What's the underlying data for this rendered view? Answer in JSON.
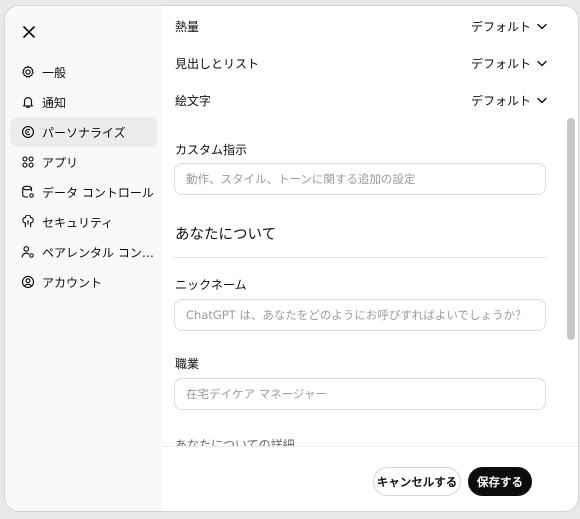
{
  "sidebar": {
    "close_icon": "close-icon",
    "items": [
      {
        "label": "一般",
        "icon": "gear-icon",
        "active": false
      },
      {
        "label": "通知",
        "icon": "bell-icon",
        "active": false
      },
      {
        "label": "パーソナライズ",
        "icon": "personalize-icon",
        "active": true
      },
      {
        "label": "アプリ",
        "icon": "apps-grid-icon",
        "active": false
      },
      {
        "label": "データ コントロール",
        "icon": "data-control-icon",
        "active": false
      },
      {
        "label": "セキュリティ",
        "icon": "security-icon",
        "active": false
      },
      {
        "label": "ペアレンタル コントロール",
        "icon": "parental-icon",
        "active": false
      },
      {
        "label": "アカウント",
        "icon": "account-icon",
        "active": false
      }
    ]
  },
  "settings": {
    "enthusiasm": {
      "label": "熱量",
      "value": "デフォルト"
    },
    "headings_lists": {
      "label": "見出しとリスト",
      "value": "デフォルト"
    },
    "emoji": {
      "label": "絵文字",
      "value": "デフォルト"
    }
  },
  "custom_instructions": {
    "label": "カスタム指示",
    "placeholder": "動作、スタイル、トーンに関する追加の設定"
  },
  "about_you": {
    "title": "あなたについて",
    "nickname": {
      "label": "ニックネーム",
      "placeholder": "ChatGPT は、あなたをどのようにお呼びすればよいでしょうか？"
    },
    "occupation": {
      "label": "職業",
      "placeholder": "在宅デイケア マネージャー"
    },
    "more_label": "あなたについての詳細"
  },
  "footer": {
    "cancel_label": "キャンセルする",
    "save_label": "保存する"
  }
}
